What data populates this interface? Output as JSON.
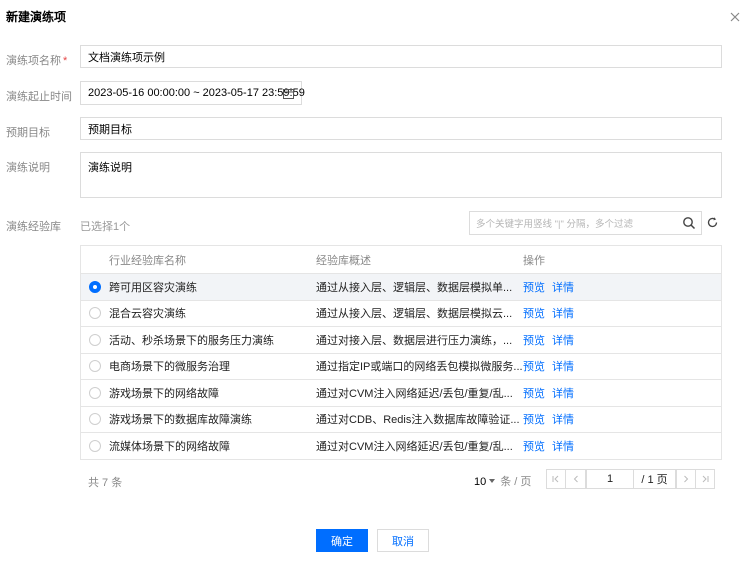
{
  "dialog": {
    "title": "新建演练项"
  },
  "form": {
    "name_label": "演练项名称",
    "required_mark": "*",
    "name_value": "文档演练项示例",
    "time_label": "演练起止时间",
    "time_value": "2023-05-16 00:00:00 ~ 2023-05-17 23:59:59",
    "goal_label": "预期目标",
    "goal_value": "预期目标",
    "desc_label": "演练说明",
    "desc_value": "演练说明",
    "library_label": "演练经验库"
  },
  "library": {
    "selected_text": "已选择1个",
    "search_placeholder": "多个关键字用竖线 \"|\" 分隔，多个过滤",
    "columns": {
      "name": "行业经验库名称",
      "desc": "经验库概述",
      "ops": "操作"
    },
    "op_preview": "预览",
    "op_detail": "详情",
    "rows": [
      {
        "name": "跨可用区容灾演练",
        "desc": "通过从接入层、逻辑层、数据层模拟单...",
        "selected": true
      },
      {
        "name": "混合云容灾演练",
        "desc": "通过从接入层、逻辑层、数据层模拟云...",
        "selected": false
      },
      {
        "name": "活动、秒杀场景下的服务压力演练",
        "desc": "通过对接入层、数据层进行压力演练，...",
        "selected": false
      },
      {
        "name": "电商场景下的微服务治理",
        "desc": "通过指定IP或端口的网络丢包模拟微服务...",
        "selected": false
      },
      {
        "name": "游戏场景下的网络故障",
        "desc": "通过对CVM注入网络延迟/丢包/重复/乱...",
        "selected": false
      },
      {
        "name": "游戏场景下的数据库故障演练",
        "desc": "通过对CDB、Redis注入数据库故障验证...",
        "selected": false
      },
      {
        "name": "流媒体场景下的网络故障",
        "desc": "通过对CVM注入网络延迟/丢包/重复/乱...",
        "selected": false
      }
    ]
  },
  "pagination": {
    "total": "共 7 条",
    "page_size": "10",
    "page_size_unit": "条 / 页",
    "current_page": "1",
    "total_pages": "/ 1 页"
  },
  "footer": {
    "confirm": "确定",
    "cancel": "取消"
  },
  "colors": {
    "accent": "#006eff",
    "required": "#e54545"
  }
}
